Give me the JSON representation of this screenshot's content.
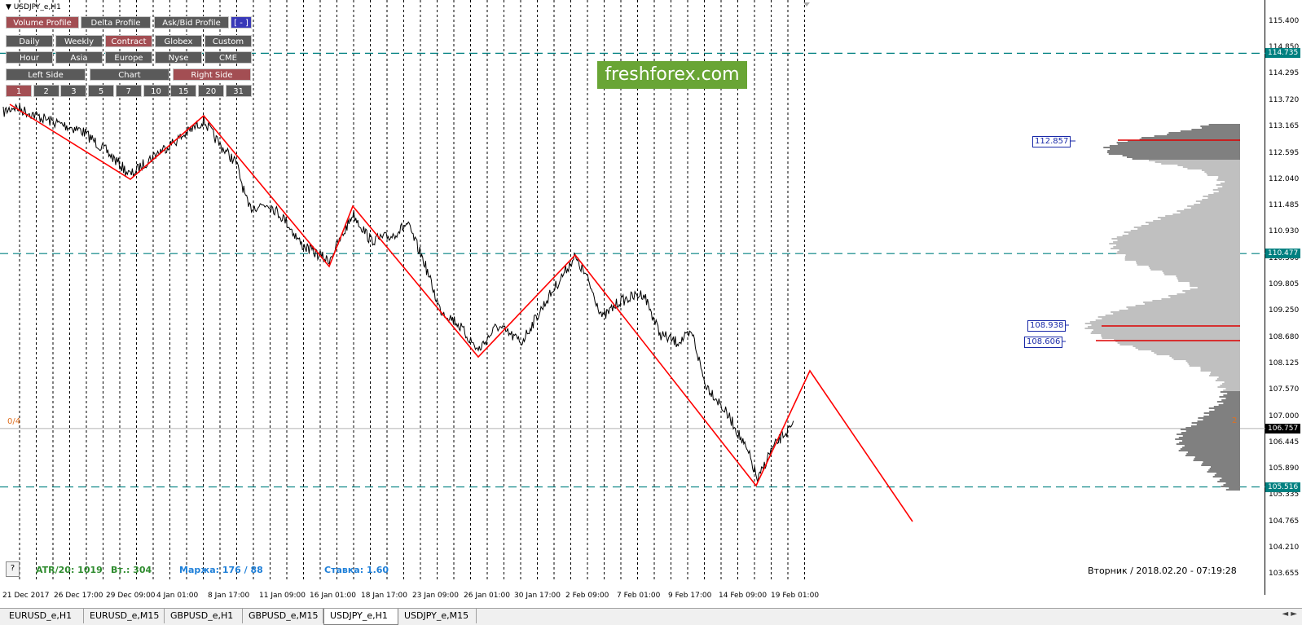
{
  "window": {
    "title": "USDJPY_e,H1"
  },
  "mode_buttons": [
    {
      "label": "Volume Profile",
      "active": true
    },
    {
      "label": "Delta Profile",
      "active": false
    },
    {
      "label": "Ask/Bid Profile",
      "active": false
    },
    {
      "label": "[ - ]",
      "active": false
    }
  ],
  "period_buttons": [
    {
      "label": "Daily",
      "active": false
    },
    {
      "label": "Weekly",
      "active": false
    },
    {
      "label": "Contract",
      "active": true
    },
    {
      "label": "Globex",
      "active": false
    },
    {
      "label": "Custom",
      "active": false
    }
  ],
  "session_buttons": [
    {
      "label": "Hour",
      "active": false
    },
    {
      "label": "Asia",
      "active": false
    },
    {
      "label": "Europe",
      "active": false
    },
    {
      "label": "Nyse",
      "active": false
    },
    {
      "label": "CME",
      "active": false
    }
  ],
  "side_buttons": [
    {
      "label": "Left Side",
      "active": false
    },
    {
      "label": "Chart",
      "active": false
    },
    {
      "label": "Right Side",
      "active": true
    }
  ],
  "count_buttons": [
    {
      "label": "1",
      "active": true
    },
    {
      "label": "2",
      "active": false
    },
    {
      "label": "3",
      "active": false
    },
    {
      "label": "5",
      "active": false
    },
    {
      "label": "7",
      "active": false
    },
    {
      "label": "10",
      "active": false
    },
    {
      "label": "15",
      "active": false
    },
    {
      "label": "20",
      "active": false
    },
    {
      "label": "31",
      "active": false
    }
  ],
  "logo": {
    "text": "freshforex.com"
  },
  "price_axis": {
    "labels": [
      "115.400",
      "114.850",
      "114.295",
      "113.720",
      "113.165",
      "112.595",
      "112.040",
      "111.485",
      "110.930",
      "110.360",
      "109.805",
      "109.250",
      "108.680",
      "108.125",
      "107.570",
      "107.000",
      "106.445",
      "105.890",
      "105.335",
      "104.765",
      "104.210",
      "103.655"
    ],
    "highlights": [
      {
        "price": "114.735",
        "type": "level"
      },
      {
        "price": "110.477",
        "type": "level"
      },
      {
        "price": "106.757",
        "type": "current"
      },
      {
        "price": "105.516",
        "type": "level"
      }
    ]
  },
  "time_axis": {
    "labels": [
      "21 Dec 2017",
      "26 Dec 17:00",
      "29 Dec 09:00",
      "4 Jan 01:00",
      "8 Jan 17:00",
      "11 Jan 09:00",
      "16 Jan 01:00",
      "18 Jan 17:00",
      "23 Jan 09:00",
      "26 Jan 01:00",
      "30 Jan 17:00",
      "2 Feb 09:00",
      "7 Feb 01:00",
      "9 Feb 17:00",
      "14 Feb 09:00",
      "19 Feb 01:00"
    ]
  },
  "profile_levels": [
    {
      "label": "112.857"
    },
    {
      "label": "108.938"
    },
    {
      "label": "108.606"
    }
  ],
  "stats": {
    "atr": "ATR/20: 1019",
    "vt": "Вт.: 304",
    "margin": "Маржа: 176 / 88",
    "rate": "Ставка: 1.60"
  },
  "markers": {
    "left": "0/4",
    "right": "2"
  },
  "help_button": "?",
  "datetime": "Вторник  /  2018.02.20  -  07:19:28",
  "tabs": [
    {
      "label": "EURUSD_e,H1",
      "active": false
    },
    {
      "label": "EURUSD_e,M15",
      "active": false
    },
    {
      "label": "GBPUSD_e,H1",
      "active": false
    },
    {
      "label": "GBPUSD_e,M15",
      "active": false
    },
    {
      "label": "USDJPY_e,H1",
      "active": true
    },
    {
      "label": "USDJPY_e,M15",
      "active": false
    }
  ],
  "colors": {
    "zigzag": "#ff0000",
    "levels": "#008080",
    "profile_dark": "#808080",
    "profile_light": "#c0c0c0",
    "button_active": "#a34e53",
    "button_normal": "#5a5a5a",
    "logo_bg": "#69a535",
    "atr_text": "#2e8b2e",
    "info_text": "#1e7fd8"
  }
}
